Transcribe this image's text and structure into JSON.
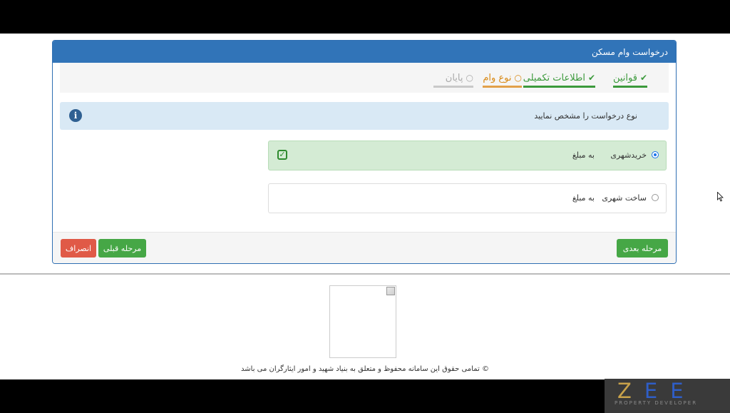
{
  "panel": {
    "title": "درخواست وام مسکن"
  },
  "steps": [
    {
      "label": "قوانین",
      "state": "done",
      "icon": "check-circle-icon"
    },
    {
      "label": "اطلاعات تکمیلی",
      "state": "done",
      "icon": "check-circle-icon"
    },
    {
      "label": "نوع وام",
      "state": "current",
      "icon": "circle-icon"
    },
    {
      "label": "پایان",
      "state": "future",
      "icon": "circle-icon"
    }
  ],
  "info": {
    "text": "نوع درخواست را مشخص نمایید"
  },
  "options": [
    {
      "label": "خریدشهری",
      "amount_label": "به مبلغ",
      "selected": true
    },
    {
      "label": "ساخت شهری",
      "amount_label": "به مبلغ",
      "selected": false
    }
  ],
  "buttons": {
    "next": "مرحله بعدی",
    "prev": "مرحله قبلی",
    "cancel": "انصراف"
  },
  "footer": {
    "copyright": "© تمامی حقوق این سامانه محفوظ و متعلق به بنیاد شهید و امور ایثارگران می باشد"
  },
  "watermark": {
    "letters": "ZEE",
    "sub": "PROPERTY DEVELOPER"
  },
  "colors": {
    "header": "#3174b8",
    "success": "#46a746",
    "danger": "#e05a47",
    "current_step": "#d98a17",
    "info_bg": "#d9e9f5"
  }
}
